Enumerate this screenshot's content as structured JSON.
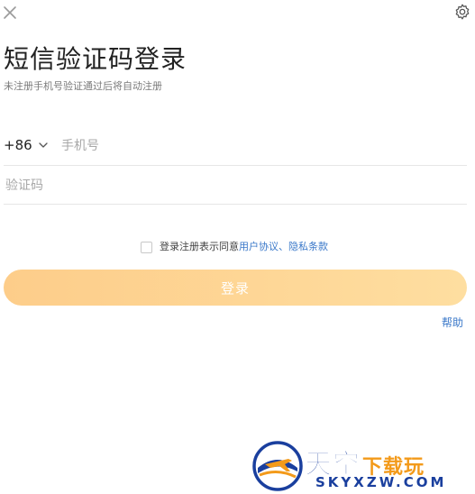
{
  "icons": {
    "close": "close-icon",
    "settings": "gear-icon",
    "dropdown": "chevron-down-icon"
  },
  "header": {
    "title": "短信验证码登录",
    "subtitle": "未注册手机号验证通过后将自动注册"
  },
  "phone": {
    "country_code": "+86",
    "placeholder": "手机号",
    "value": ""
  },
  "code": {
    "placeholder": "验证码",
    "value": ""
  },
  "agreement": {
    "checked": false,
    "prefix": "登录注册表示同意",
    "user_agreement": "用户协议",
    "separator": "、",
    "privacy_policy": "隐私条款"
  },
  "login_button": {
    "label": "登录",
    "enabled": false
  },
  "help_link": "帮助",
  "watermark": {
    "logo_text": "天空下载玩",
    "site": "SKYXZW.COM"
  },
  "colors": {
    "button_gradient_start": "#fdcd8a",
    "button_gradient_end": "#fedea0",
    "link": "#3a78c9",
    "watermark_blue": "#1a3f9e",
    "watermark_orange": "#f39a1a"
  }
}
